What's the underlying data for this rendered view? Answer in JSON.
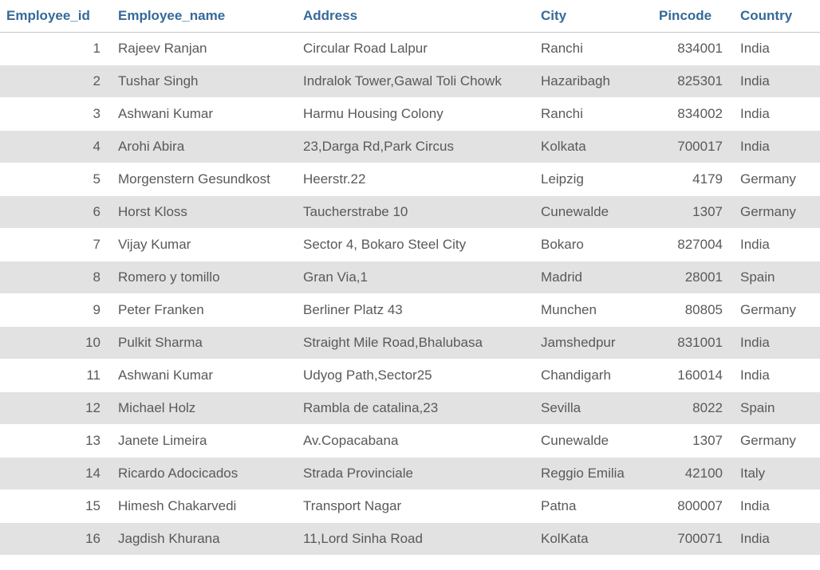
{
  "headers": {
    "employee_id": "Employee_id",
    "employee_name": "Employee_name",
    "address": "Address",
    "city": "City",
    "pincode": "Pincode",
    "country": "Country"
  },
  "rows": [
    {
      "id": "1",
      "name": "Rajeev Ranjan",
      "address": "Circular Road Lalpur",
      "city": "Ranchi",
      "pincode": "834001",
      "country": "India"
    },
    {
      "id": "2",
      "name": "Tushar Singh",
      "address": "Indralok Tower,Gawal Toli Chowk",
      "city": "Hazaribagh",
      "pincode": "825301",
      "country": "India"
    },
    {
      "id": "3",
      "name": "Ashwani Kumar",
      "address": "Harmu Housing Colony",
      "city": "Ranchi",
      "pincode": "834002",
      "country": "India"
    },
    {
      "id": "4",
      "name": "Arohi Abira",
      "address": "23,Darga Rd,Park Circus",
      "city": "Kolkata",
      "pincode": "700017",
      "country": "India"
    },
    {
      "id": "5",
      "name": "Morgenstern Gesundkost",
      "address": "Heerstr.22",
      "city": "Leipzig",
      "pincode": "4179",
      "country": "Germany"
    },
    {
      "id": "6",
      "name": "Horst Kloss",
      "address": "Taucherstrabe 10",
      "city": "Cunewalde",
      "pincode": "1307",
      "country": "Germany"
    },
    {
      "id": "7",
      "name": "Vijay Kumar",
      "address": "Sector 4, Bokaro Steel City",
      "city": "Bokaro",
      "pincode": "827004",
      "country": "India"
    },
    {
      "id": "8",
      "name": "Romero y tomillo",
      "address": "Gran Via,1",
      "city": "Madrid",
      "pincode": "28001",
      "country": "Spain"
    },
    {
      "id": "9",
      "name": "Peter Franken",
      "address": "Berliner Platz 43",
      "city": "Munchen",
      "pincode": "80805",
      "country": "Germany"
    },
    {
      "id": "10",
      "name": "Pulkit Sharma",
      "address": "Straight Mile Road,Bhalubasa",
      "city": "Jamshedpur",
      "pincode": "831001",
      "country": "India"
    },
    {
      "id": "11",
      "name": "Ashwani Kumar",
      "address": "Udyog Path,Sector25",
      "city": "Chandigarh",
      "pincode": "160014",
      "country": "India"
    },
    {
      "id": "12",
      "name": "Michael Holz",
      "address": "Rambla de catalina,23",
      "city": "Sevilla",
      "pincode": "8022",
      "country": "Spain"
    },
    {
      "id": "13",
      "name": "Janete Limeira",
      "address": "Av.Copacabana",
      "city": "Cunewalde",
      "pincode": "1307",
      "country": "Germany"
    },
    {
      "id": "14",
      "name": "Ricardo Adocicados",
      "address": "Strada Provinciale",
      "city": "Reggio Emilia",
      "pincode": "42100",
      "country": "Italy"
    },
    {
      "id": "15",
      "name": "Himesh Chakarvedi",
      "address": "Transport Nagar",
      "city": "Patna",
      "pincode": "800007",
      "country": "India"
    },
    {
      "id": "16",
      "name": "Jagdish Khurana",
      "address": "11,Lord Sinha Road",
      "city": "KolKata",
      "pincode": "700071",
      "country": "India"
    }
  ]
}
